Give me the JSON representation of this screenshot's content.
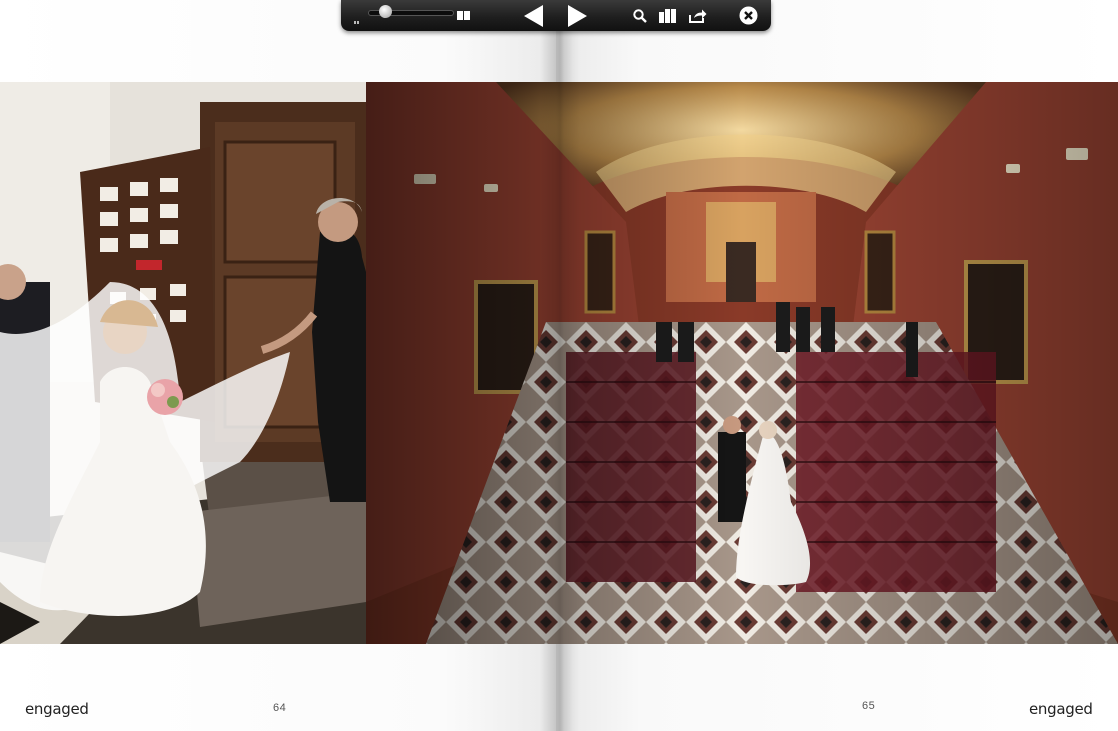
{
  "toolbar": {
    "zoom_level": 0.2,
    "icons": {
      "zoom_min": "small-pages-icon",
      "zoom_max": "large-pages-icon",
      "prev": "triangle-left-icon",
      "next": "triangle-right-icon",
      "search": "magnifier-icon",
      "thumbnails": "thumbnails-icon",
      "share": "share-arrow-icon",
      "close": "close-circle-icon"
    },
    "colors": {
      "background": "#1c1c1c",
      "icon": "#ffffff"
    }
  },
  "pages": {
    "left": {
      "number": "64",
      "brand": "engaged"
    },
    "right": {
      "number": "65",
      "brand": "engaged"
    }
  },
  "photos": {
    "left": {
      "subject": "bride-veil-doorway-photo"
    },
    "right": {
      "subject": "church-aisle-wedding-photo"
    }
  }
}
